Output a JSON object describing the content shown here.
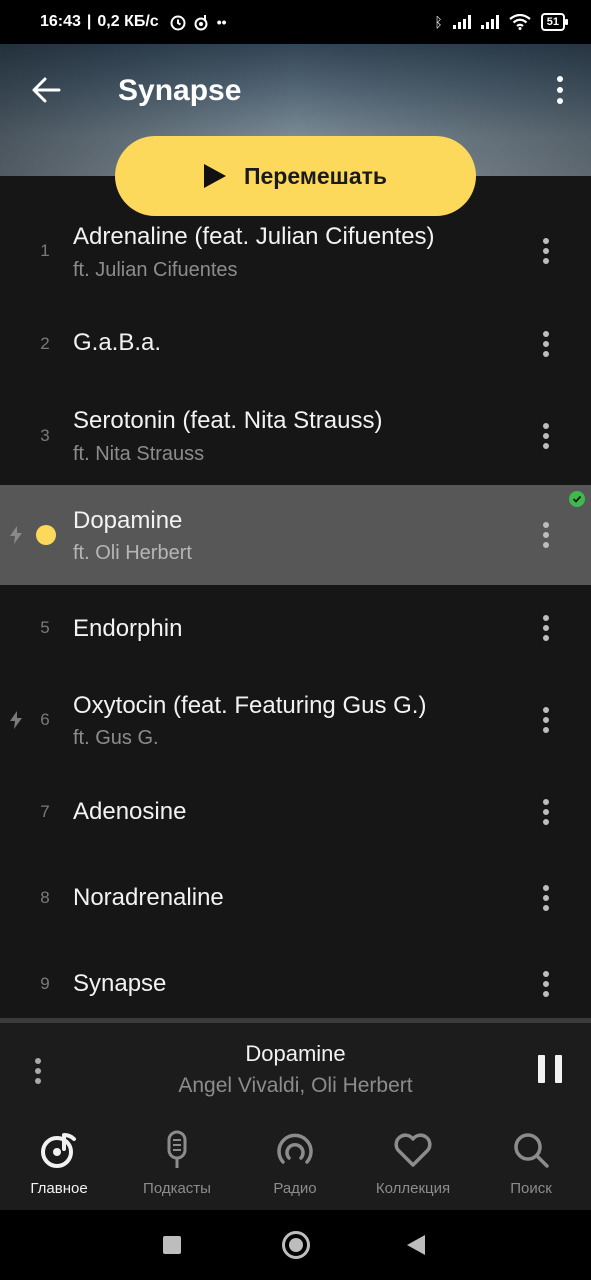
{
  "status_bar": {
    "time": "16:43",
    "network_speed": "0,2 КБ/с",
    "icons_left": [
      "alarm-icon",
      "music-note-icon",
      "more-dots"
    ],
    "icons_right": [
      "bluetooth-icon",
      "signal-icon",
      "signal-icon",
      "wifi-icon"
    ],
    "battery": "51"
  },
  "header": {
    "title": "Synapse",
    "back_icon": "arrow-left-icon",
    "menu_icon": "more-vertical-icon"
  },
  "shuffle_button": {
    "label": "Перемешать",
    "icon": "play-icon",
    "color": "#fcd95b"
  },
  "tracks": [
    {
      "number": "1",
      "title": "Adrenaline (feat. Julian Cifuentes)",
      "subtitle": "ft. Julian Cifuentes"
    },
    {
      "number": "2",
      "title": "G.a.B.a.",
      "subtitle": ""
    },
    {
      "number": "3",
      "title": "Serotonin (feat. Nita Strauss)",
      "subtitle": "ft. Nita Strauss"
    },
    {
      "number": "",
      "title": "Dopamine",
      "subtitle": "ft. Oli Herbert",
      "playing": true,
      "downloaded": true
    },
    {
      "number": "5",
      "title": "Endorphin",
      "subtitle": ""
    },
    {
      "number": "6",
      "title": "Oxytocin (feat. Featuring Gus G.)",
      "subtitle": "ft. Gus G."
    },
    {
      "number": "7",
      "title": "Adenosine",
      "subtitle": ""
    },
    {
      "number": "8",
      "title": "Noradrenaline",
      "subtitle": ""
    },
    {
      "number": "9",
      "title": "Synapse",
      "subtitle": ""
    }
  ],
  "mini_player": {
    "title": "Dopamine",
    "artist": "Angel Vivaldi, Oli Herbert",
    "state_icon": "pause-icon"
  },
  "bottom_nav": [
    {
      "label": "Главное",
      "icon": "music-home-icon",
      "active": true
    },
    {
      "label": "Подкасты",
      "icon": "microphone-icon"
    },
    {
      "label": "Радио",
      "icon": "radio-icon"
    },
    {
      "label": "Коллекция",
      "icon": "heart-icon"
    },
    {
      "label": "Поиск",
      "icon": "search-icon"
    }
  ],
  "colors": {
    "accent": "#fcd95b",
    "background": "#161616",
    "active_row": "#575757",
    "download_badge": "#3dbb4a"
  }
}
